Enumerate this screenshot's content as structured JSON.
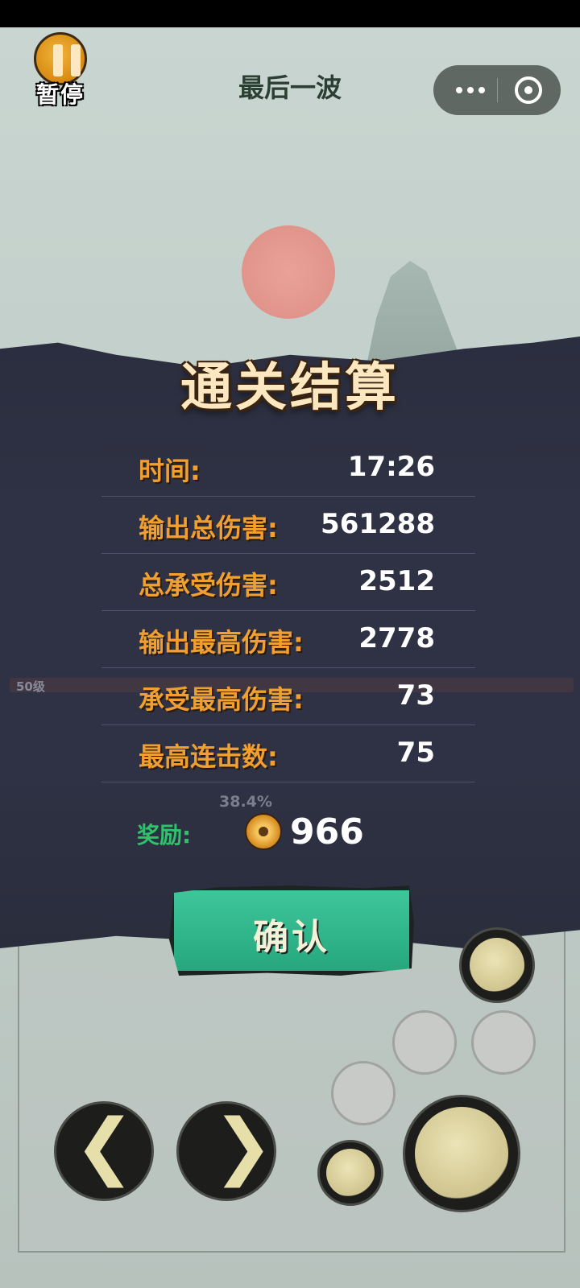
{
  "top": {
    "pause_label": "暂停",
    "title": "最后一波"
  },
  "battle": {
    "level_label": "50级",
    "boss_percent": "38.4%"
  },
  "result": {
    "title": "通关结算",
    "stats": [
      {
        "label": "时间:",
        "value": "17:26"
      },
      {
        "label": "输出总伤害:",
        "value": "561288"
      },
      {
        "label": "总承受伤害:",
        "value": "2512"
      },
      {
        "label": "输出最高伤害:",
        "value": "2778"
      },
      {
        "label": "承受最高伤害:",
        "value": "73"
      },
      {
        "label": "最高连击数:",
        "value": "75"
      }
    ],
    "reward_label": "奖励:",
    "reward_value": "966",
    "confirm_label": "确认"
  },
  "colors": {
    "stat_label": "#f0a032",
    "reward_label": "#2ec26a",
    "confirm_button": "#2fb88a",
    "panel": "#2f3244"
  },
  "icons": {
    "pause": "pause-icon",
    "menu": "more-dots-icon",
    "close": "target-icon",
    "coin": "coin-icon",
    "left": "arrow-left-icon",
    "right": "arrow-right-icon"
  }
}
